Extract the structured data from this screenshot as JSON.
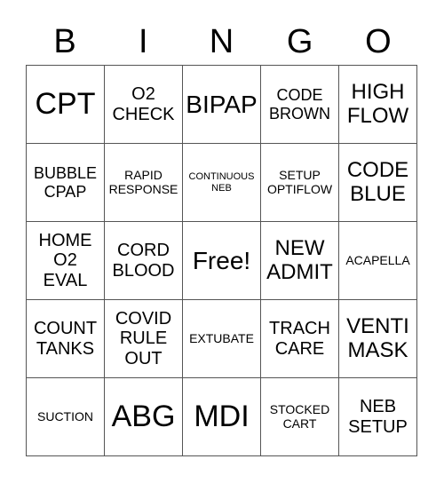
{
  "header": {
    "letters": [
      "B",
      "I",
      "N",
      "G",
      "O"
    ]
  },
  "card": {
    "rows": [
      [
        "CPT",
        "O2\nCHECK",
        "BIPAP",
        "CODE\nBROWN",
        "HIGH\nFLOW"
      ],
      [
        "BUBBLE\nCPAP",
        "RAPID\nRESPONSE",
        "CONTINUOUS\nNEB",
        "SETUP\nOPTIFLOW",
        "CODE\nBLUE"
      ],
      [
        "HOME\nO2\nEVAL",
        "CORD\nBLOOD",
        "Free!",
        "NEW\nADMIT",
        "ACAPELLA"
      ],
      [
        "COUNT\nTANKS",
        "COVID\nRULE\nOUT",
        "EXTUBATE",
        "TRACH\nCARE",
        "VENTI\nMASK"
      ],
      [
        "SUCTION",
        "ABG",
        "MDI",
        "STOCKED\nCART",
        "NEB\nSETUP"
      ]
    ]
  }
}
